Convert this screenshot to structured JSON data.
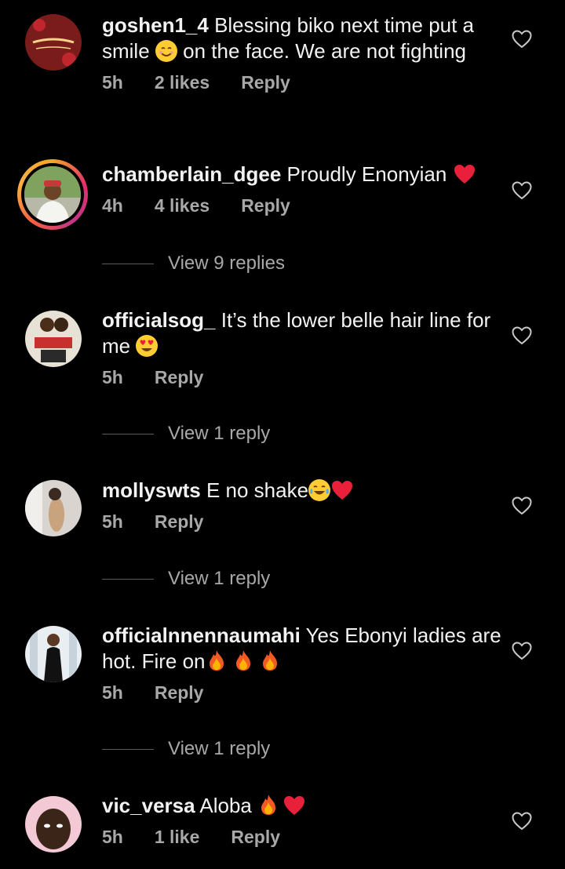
{
  "comments": [
    {
      "username": "goshen1_4",
      "text_a": "Blessing biko next time put a smile ",
      "text_b": " on the face. We are not fighting",
      "time": "5h",
      "likes": "2 likes",
      "reply": "Reply"
    },
    {
      "username": "chamberlain_dgee",
      "text_a": "Proudly Enonyian ",
      "time": "4h",
      "likes": "4 likes",
      "reply": "Reply",
      "view_replies": "View 9 replies"
    },
    {
      "username": "officialsog_",
      "text_a": "It’s the lower belle hair line for me ",
      "time": "5h",
      "reply": "Reply",
      "view_replies": "View 1 reply"
    },
    {
      "username": "mollyswts",
      "text_a": "E no shake",
      "time": "5h",
      "reply": "Reply",
      "view_replies": "View 1 reply"
    },
    {
      "username": "officialnnennaumahi",
      "text_a": "Yes Ebonyi ladies are hot. Fire on",
      "time": "5h",
      "reply": "Reply",
      "view_replies": "View 1 reply"
    },
    {
      "username": "vic_versa",
      "text_a": "Aloba ",
      "time": "5h",
      "likes": "1 like",
      "reply": "Reply"
    }
  ],
  "colors": {
    "background": "#000000",
    "text": "#f2f2f2",
    "meta": "#a8a8a8",
    "heart_emoji": "#e8203a",
    "story_ring": "#e1306c"
  },
  "icons": [
    "heart-outline-icon",
    "smile-emoji",
    "red-heart-emoji",
    "heart-eyes-emoji",
    "tears-of-joy-emoji",
    "fire-emoji"
  ]
}
